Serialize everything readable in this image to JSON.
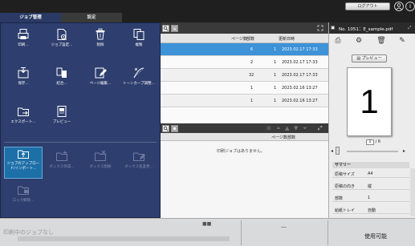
{
  "top": {
    "tabs": [
      {
        "label": "ジョブ管理",
        "active": true
      },
      {
        "label": "設定",
        "active": false
      }
    ],
    "logout_label": "ログアウト",
    "icons": [
      "user-settings-icon",
      "info-icon"
    ],
    "info_glyph": "i"
  },
  "job_menu": {
    "items": [
      {
        "label": "印刷...",
        "icon": "print-icon"
      },
      {
        "label": "ジョブ設定...",
        "icon": "job-settings-icon"
      },
      {
        "label": "削除",
        "icon": "trash-icon"
      },
      {
        "label": "複製",
        "icon": "duplicate-icon"
      },
      {
        "label": "保存...",
        "icon": "save-icon"
      },
      {
        "label": "結合...",
        "icon": "merge-icon"
      },
      {
        "label": "ページ編集...",
        "icon": "page-edit-icon"
      },
      {
        "label": "トーンカーブ調整...",
        "icon": "tone-curve-icon"
      },
      {
        "label": "エクスポート...",
        "icon": "export-icon"
      },
      {
        "label": "プレビュー",
        "icon": "preview-icon"
      }
    ],
    "box_items": [
      {
        "label": "ジョブのアップロード/インポート...",
        "icon": "box-upload-icon",
        "highlight": true
      },
      {
        "label": "ボックス作成...",
        "icon": "box-create-icon",
        "disabled": true
      },
      {
        "label": "ボックス削除",
        "icon": "box-delete-icon",
        "disabled": true
      },
      {
        "label": "ボックス名変更...",
        "icon": "box-rename-icon",
        "disabled": true
      },
      {
        "label": "ロック解除...",
        "icon": "unlock-icon",
        "disabled": true
      }
    ]
  },
  "job_list": {
    "headers": {
      "pages": "ページ数",
      "copies": "部数",
      "updated": "更新日時"
    },
    "rows": [
      {
        "pages": "6",
        "copies": "1",
        "updated": "2023.02.17 17:33",
        "selected": true
      },
      {
        "pages": "2",
        "copies": "1",
        "updated": "2023.02.17 17:33"
      },
      {
        "pages": "32",
        "copies": "1",
        "updated": "2023.02.17 17:33"
      },
      {
        "pages": "1",
        "copies": "1",
        "updated": "2023.02.16 13:27"
      },
      {
        "pages": "1",
        "copies": "1",
        "updated": "2023.02.16 13:27"
      }
    ]
  },
  "print_queue": {
    "header_pages": "ページ数",
    "header_copies": "部数",
    "empty_message": "印刷ジョブはありません。"
  },
  "right_panel": {
    "title": "No. 1051：E_sample.pdf",
    "preview_label": "プレビュー",
    "page_number_display": "1",
    "page_current": "1",
    "page_total_label": "/ 6",
    "summary_title": "サマリー",
    "summary": [
      {
        "key": "原稿サイズ",
        "value": "A4"
      },
      {
        "key": "原稿の向き",
        "value": "縦"
      },
      {
        "key": "部数",
        "value": "1"
      },
      {
        "key": "給紙トレイ",
        "value": "自動"
      }
    ]
  },
  "bottom": {
    "status_text": "印刷中のジョブなし",
    "dash": "—",
    "ready_text": "使用可能",
    "dots": "■■"
  },
  "colors": {
    "menu_bg": "#2e3e6e",
    "selected_row": "#3d92d8",
    "active_tab": "#2a3a64"
  }
}
